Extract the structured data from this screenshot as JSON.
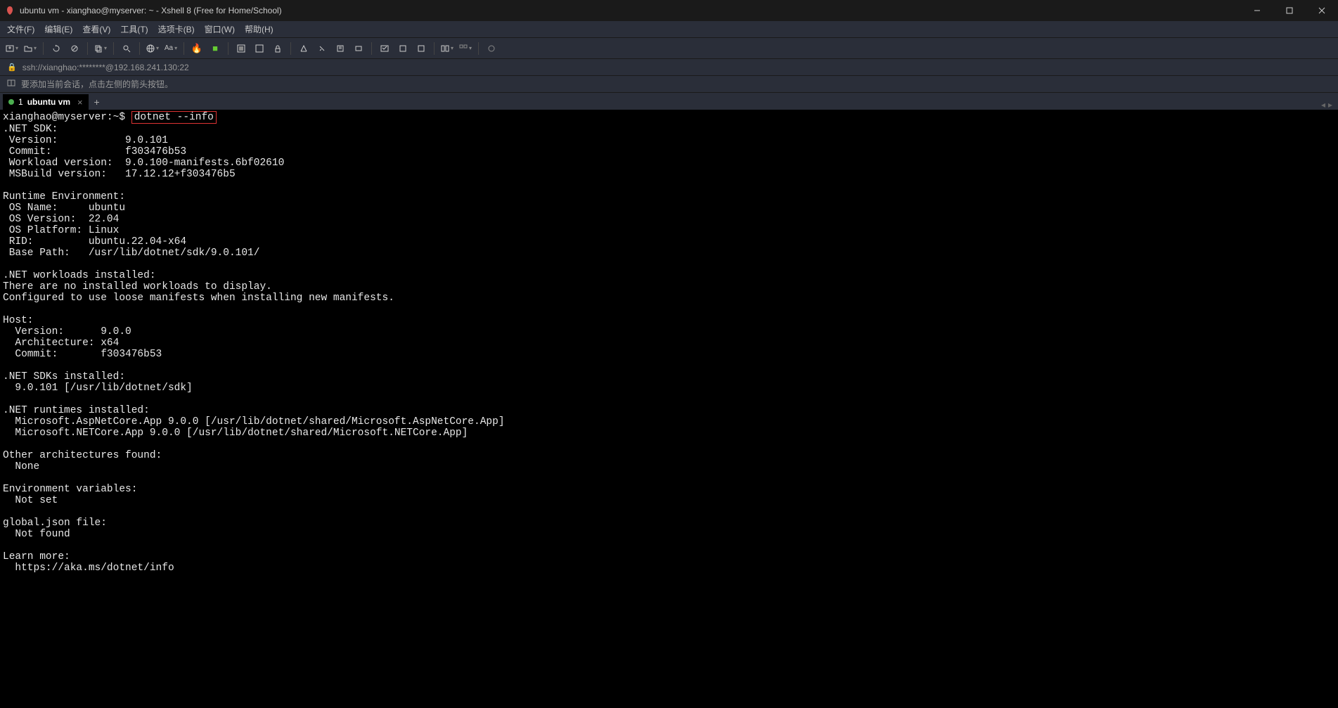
{
  "window": {
    "title": "ubuntu vm - xianghao@myserver: ~ - Xshell 8 (Free for Home/School)"
  },
  "menubar": [
    "文件(F)",
    "编辑(E)",
    "查看(V)",
    "工具(T)",
    "选项卡(B)",
    "窗口(W)",
    "帮助(H)"
  ],
  "address": "ssh://xianghao:********@192.168.241.130:22",
  "hint": "要添加当前会话，点击左侧的箭头按钮。",
  "tab": {
    "index": "1",
    "label": "ubuntu vm"
  },
  "terminal": {
    "prompt": "xianghao@myserver:~$",
    "command": "dotnet --info",
    "lines": [
      ".NET SDK:",
      " Version:           9.0.101",
      " Commit:            f303476b53",
      " Workload version:  9.0.100-manifests.6bf02610",
      " MSBuild version:   17.12.12+f303476b5",
      "",
      "Runtime Environment:",
      " OS Name:     ubuntu",
      " OS Version:  22.04",
      " OS Platform: Linux",
      " RID:         ubuntu.22.04-x64",
      " Base Path:   /usr/lib/dotnet/sdk/9.0.101/",
      "",
      ".NET workloads installed:",
      "There are no installed workloads to display.",
      "Configured to use loose manifests when installing new manifests.",
      "",
      "Host:",
      "  Version:      9.0.0",
      "  Architecture: x64",
      "  Commit:       f303476b53",
      "",
      ".NET SDKs installed:",
      "  9.0.101 [/usr/lib/dotnet/sdk]",
      "",
      ".NET runtimes installed:",
      "  Microsoft.AspNetCore.App 9.0.0 [/usr/lib/dotnet/shared/Microsoft.AspNetCore.App]",
      "  Microsoft.NETCore.App 9.0.0 [/usr/lib/dotnet/shared/Microsoft.NETCore.App]",
      "",
      "Other architectures found:",
      "  None",
      "",
      "Environment variables:",
      "  Not set",
      "",
      "global.json file:",
      "  Not found",
      "",
      "Learn more:",
      "  https://aka.ms/dotnet/info"
    ]
  },
  "icons": {
    "app": "🔥"
  }
}
